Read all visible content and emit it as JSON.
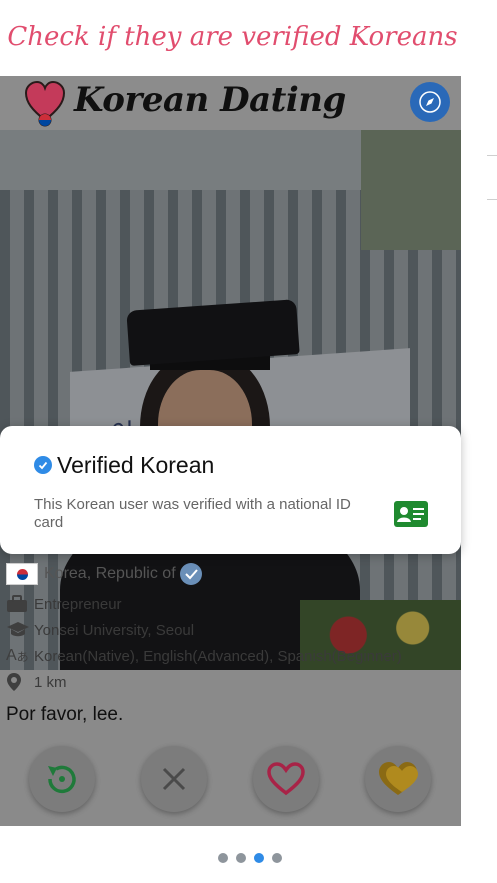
{
  "caption": "Check if they are verified Koreans",
  "header": {
    "title": "Korean Dating"
  },
  "photo": {
    "banner_text": "이 CLA"
  },
  "verification": {
    "title": "Verified Korean",
    "description": "This Korean user was verified with a national ID card"
  },
  "profile": {
    "country": "Korea, Republic of",
    "occupation": "Entrepreneur",
    "school": "Yonsei University, Seoul",
    "languages": "Korean(Native), English(Advanced), Spanish(Beginner)",
    "distance": "1 km",
    "bio": "Por favor, lee."
  },
  "actions": [
    "rewind",
    "pass",
    "like",
    "super-like"
  ],
  "pager": {
    "count": 4,
    "active_index": 2
  },
  "colors": {
    "caption": "#e14d6e",
    "accent_blue": "#2f8be6",
    "like_red": "#c8284f",
    "rewind_green": "#1f7a3a",
    "superlike_gold": "#b08a1e",
    "id_green": "#1f8a2f"
  }
}
